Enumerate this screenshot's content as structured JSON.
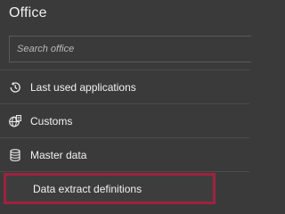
{
  "panel": {
    "title": "Office"
  },
  "search": {
    "placeholder": "Search office",
    "value": ""
  },
  "nav": {
    "items": [
      {
        "label": "Last used applications",
        "icon": "history-icon"
      },
      {
        "label": "Customs",
        "icon": "globe-document-icon"
      },
      {
        "label": "Master data",
        "icon": "database-icon"
      }
    ],
    "selected_subitem": {
      "label": "Data extract definitions"
    }
  },
  "colors": {
    "background": "#3a3a3a",
    "text": "#f2f2f2",
    "divider": "#4c4c4c",
    "highlight_border": "#a0213f"
  }
}
